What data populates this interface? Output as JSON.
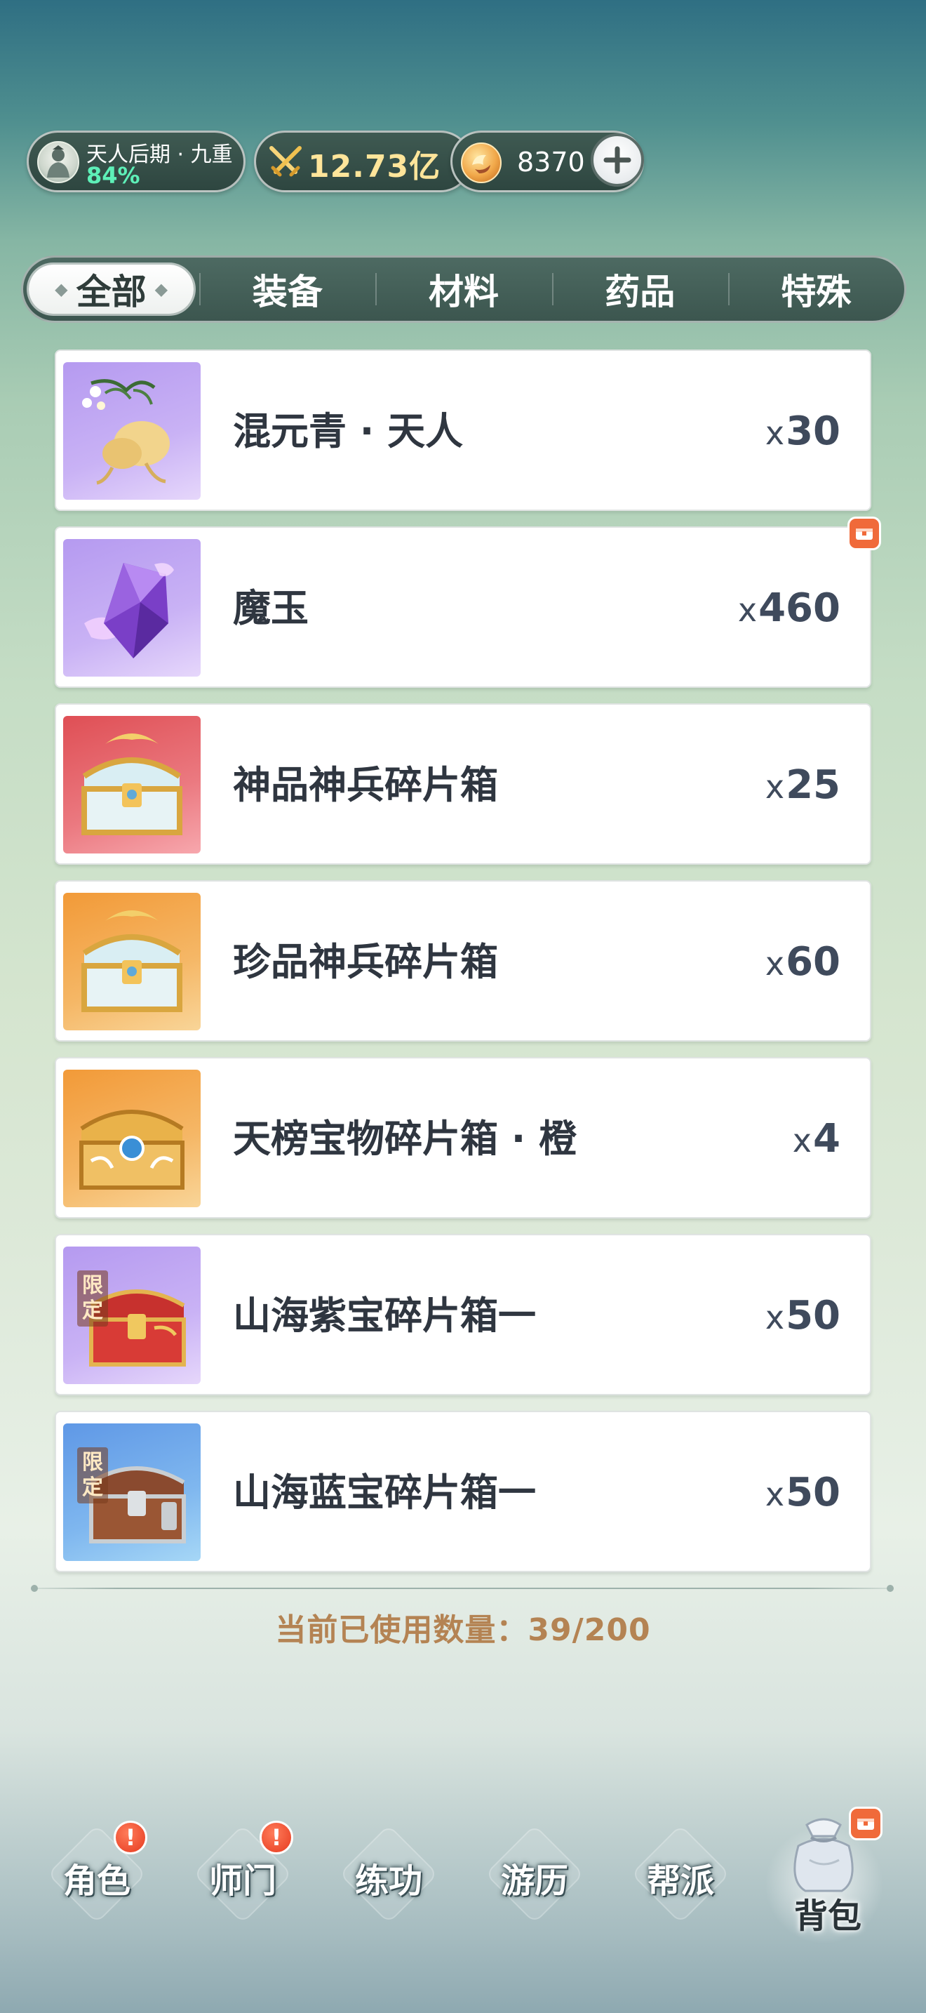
{
  "status": {
    "realm_title": "天人后期 · 九重",
    "realm_progress_text": "84%",
    "power_value": "12.73亿",
    "currency_value": "8370",
    "icons": {
      "avatar": "cultivator-avatar-icon",
      "power": "crossed-swords-icon",
      "currency": "jade-coin-icon",
      "add": "plus-icon"
    }
  },
  "tabs": [
    {
      "label": "全部",
      "active": true
    },
    {
      "label": "装备",
      "active": false
    },
    {
      "label": "材料",
      "active": false
    },
    {
      "label": "药品",
      "active": false
    },
    {
      "label": "特殊",
      "active": false
    }
  ],
  "items": [
    {
      "name": "混元青 · 天人",
      "qty_prefix": "x",
      "qty": "30",
      "rarity": "purple",
      "icon": "ginseng-root-icon",
      "limited": false,
      "new": false
    },
    {
      "name": "魔玉",
      "qty_prefix": "x",
      "qty": "460",
      "rarity": "purple",
      "icon": "purple-crystal-icon",
      "limited": false,
      "new": true
    },
    {
      "name": "神品神兵碎片箱",
      "qty_prefix": "x",
      "qty": "25",
      "rarity": "red",
      "icon": "dragon-chest-icon",
      "limited": false,
      "new": false
    },
    {
      "name": "珍品神兵碎片箱",
      "qty_prefix": "x",
      "qty": "60",
      "rarity": "orange",
      "icon": "dragon-chest-icon",
      "limited": false,
      "new": false
    },
    {
      "name": "天榜宝物碎片箱 · 橙",
      "qty_prefix": "x",
      "qty": "4",
      "rarity": "orange",
      "icon": "golden-chest-icon",
      "limited": false,
      "new": false
    },
    {
      "name": "山海紫宝碎片箱一",
      "qty_prefix": "x",
      "qty": "50",
      "rarity": "purple",
      "icon": "red-chest-icon",
      "limited": true,
      "limited_label": "限定",
      "new": false
    },
    {
      "name": "山海蓝宝碎片箱一",
      "qty_prefix": "x",
      "qty": "50",
      "rarity": "blue",
      "icon": "brown-chest-icon",
      "limited": true,
      "limited_label": "限定",
      "new": false
    }
  ],
  "capacity": {
    "label": "当前已使用数量：",
    "used": "39",
    "total": "200",
    "text": "39/200"
  },
  "bottom_nav": [
    {
      "label": "角色",
      "alert": true,
      "alert_glyph": "!"
    },
    {
      "label": "师门",
      "alert": true,
      "alert_glyph": "!"
    },
    {
      "label": "练功",
      "alert": false
    },
    {
      "label": "游历",
      "alert": false
    },
    {
      "label": "帮派",
      "alert": false
    },
    {
      "label": "背包",
      "active": true,
      "icon": "cloth-bag-icon"
    }
  ],
  "colors": {
    "rarity_purple": "#b59af0",
    "rarity_red": "#df4f55",
    "rarity_orange": "#f29a38",
    "rarity_blue": "#5f98e6",
    "capacity_text": "#b48353",
    "realm_progress": "#5ef0b8",
    "power_text": "#ffe59a"
  }
}
